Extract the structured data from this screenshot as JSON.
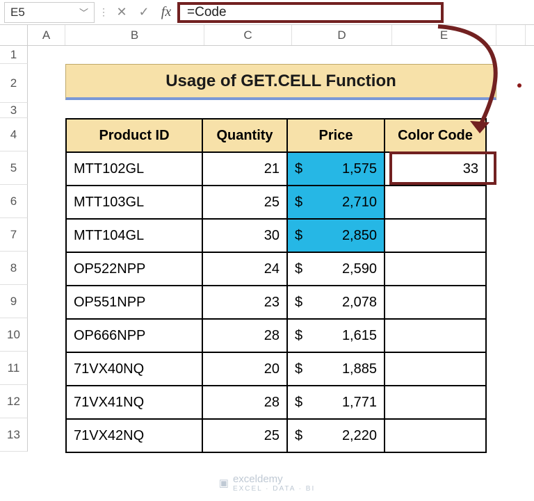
{
  "name_box": {
    "value": "E5"
  },
  "formula_bar": {
    "value": "=Code",
    "fx_label": "fx"
  },
  "columns": {
    "A": "A",
    "B": "B",
    "C": "C",
    "D": "D",
    "E": "E"
  },
  "row_numbers": [
    "1",
    "2",
    "3",
    "4",
    "5",
    "6",
    "7",
    "8",
    "9",
    "10",
    "11",
    "12",
    "13"
  ],
  "title": "Usage of GET.CELL Function",
  "headers": {
    "pid": "Product ID",
    "qty": "Quantity",
    "price": "Price",
    "cc": "Color Code"
  },
  "currency": "$",
  "rows": [
    {
      "pid": "MTT102GL",
      "qty": "21",
      "price": "1,575",
      "highlight": true,
      "cc": "33"
    },
    {
      "pid": "MTT103GL",
      "qty": "25",
      "price": "2,710",
      "highlight": true,
      "cc": ""
    },
    {
      "pid": "MTT104GL",
      "qty": "30",
      "price": "2,850",
      "highlight": true,
      "cc": ""
    },
    {
      "pid": "OP522NPP",
      "qty": "24",
      "price": "2,590",
      "highlight": false,
      "cc": ""
    },
    {
      "pid": "OP551NPP",
      "qty": "23",
      "price": "2,078",
      "highlight": false,
      "cc": ""
    },
    {
      "pid": "OP666NPP",
      "qty": "28",
      "price": "1,615",
      "highlight": false,
      "cc": ""
    },
    {
      "pid": "71VX40NQ",
      "qty": "20",
      "price": "1,885",
      "highlight": false,
      "cc": ""
    },
    {
      "pid": "71VX41NQ",
      "qty": "28",
      "price": "1,771",
      "highlight": false,
      "cc": ""
    },
    {
      "pid": "71VX42NQ",
      "qty": "25",
      "price": "2,220",
      "highlight": false,
      "cc": ""
    }
  ],
  "watermark": {
    "brand": "exceldemy",
    "tag": "EXCEL · DATA · BI"
  },
  "chart_data": {
    "type": "table",
    "title": "Usage of GET.CELL Function",
    "columns": [
      "Product ID",
      "Quantity",
      "Price",
      "Color Code"
    ],
    "rows": [
      [
        "MTT102GL",
        21,
        1575,
        33
      ],
      [
        "MTT103GL",
        25,
        2710,
        null
      ],
      [
        "MTT104GL",
        30,
        2850,
        null
      ],
      [
        "OP522NPP",
        24,
        2590,
        null
      ],
      [
        "OP551NPP",
        23,
        2078,
        null
      ],
      [
        "OP666NPP",
        28,
        1615,
        null
      ],
      [
        "71VX40NQ",
        20,
        1885,
        null
      ],
      [
        "71VX41NQ",
        28,
        1771,
        null
      ],
      [
        "71VX42NQ",
        25,
        2220,
        null
      ]
    ],
    "highlight_rows": [
      0,
      1,
      2
    ],
    "highlight_color_hex": "#26B7E5",
    "active_cell": "E5",
    "formula": "=Code"
  }
}
